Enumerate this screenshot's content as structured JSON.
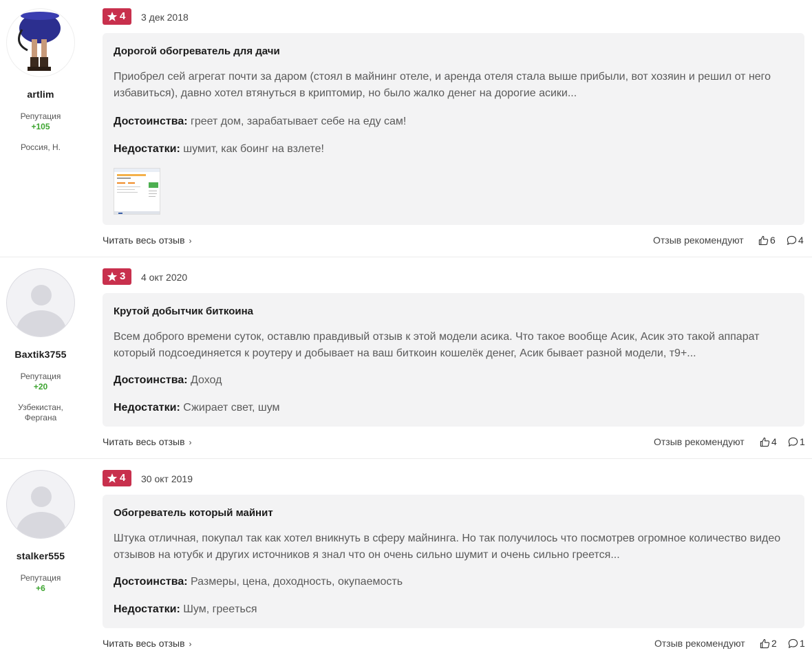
{
  "labels": {
    "reputation": "Репутация",
    "read_more": "Читать весь отзыв",
    "recommend": "Отзыв рекомендуют",
    "pros": "Достоинства:",
    "cons": "Недостатки:"
  },
  "colors": {
    "badge": "#c8304d",
    "reputation_positive": "#3da530",
    "card_bg": "#f3f3f4"
  },
  "reviews": [
    {
      "author": "artlim",
      "avatar": "user-photo",
      "reputation": "+105",
      "location": "Россия, Н.",
      "rating": "4",
      "date": "3 дек 2018",
      "title": "Дорогой обогреватель для дачи",
      "text": "Приобрел сей агрегат почти за даром (стоял в майнинг отеле, и аренда отеля стала выше прибыли, вот хозяин и решил от него избавиться), давно хотел втянуться в криптомир, но было жалко денег на дорогие асики...",
      "pros": "греет дом, зарабатывает себе на еду сам!",
      "cons": "шумит, как боинг на взлете!",
      "likes": "6",
      "comments": "4"
    },
    {
      "author": "Baxtik3755",
      "avatar": "default-avatar",
      "reputation": "+20",
      "location_line1": "Узбекистан,",
      "location_line2": "Фергана",
      "rating": "3",
      "date": "4 окт 2020",
      "title": "Крутой добытчик биткоина",
      "text": "Всем доброго времени суток, оставлю правдивый отзыв к этой модели асика. Что такое вообще Асик, Асик это такой аппарат который подсоединяется к роутеру и добывает на ваш биткоин кошелёк денег, Асик бывает разной модели, т9+...",
      "pros": "Доход",
      "cons": "Сжирает свет, шум",
      "likes": "4",
      "comments": "1"
    },
    {
      "author": "stalker555",
      "avatar": "default-avatar",
      "reputation": "+6",
      "rating": "4",
      "date": "30 окт 2019",
      "title": "Обогреватель который майнит",
      "text": "Штука отличная, покупал так как хотел вникнуть в сферу майнинга. Но так получилось что посмотрев огромное количество видео отзывов на ютубк и других источников я знал что он очень сильно шумит и очень сильно греется...",
      "pros": "Размеры, цена, доходность, окупаемость",
      "cons": "Шум, греeться",
      "likes": "2",
      "comments": "1"
    }
  ]
}
